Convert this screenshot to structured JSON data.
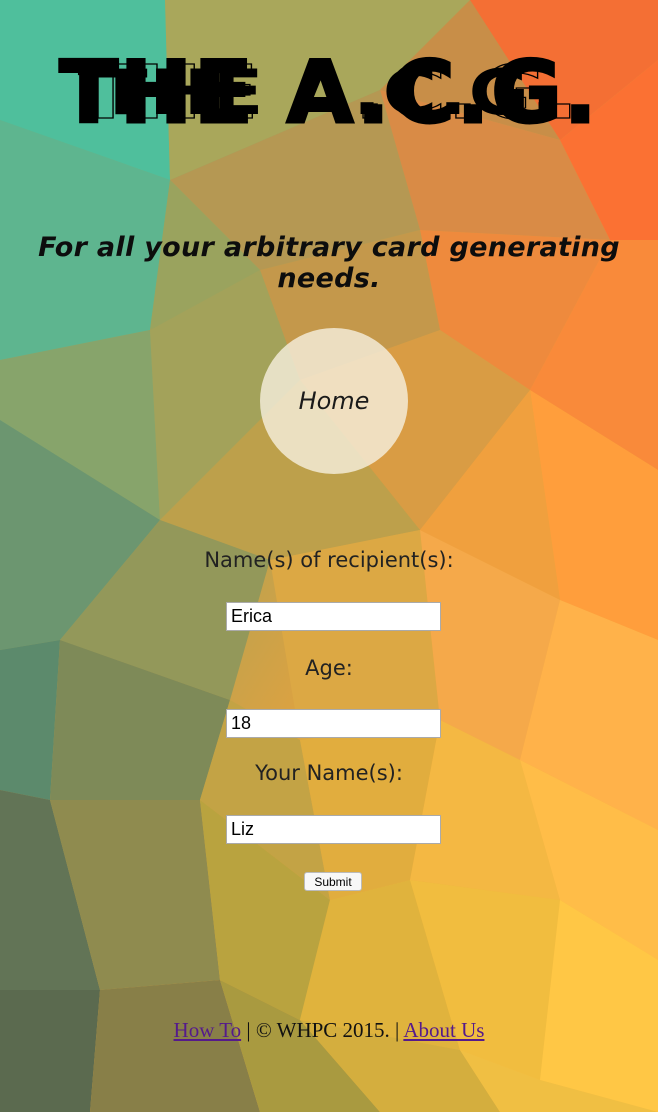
{
  "header": {
    "title": "THE A.C.G.",
    "tagline": "For all your arbitrary card generating needs."
  },
  "nav": {
    "home_label": "Home"
  },
  "form": {
    "recipient_label": "Name(s) of recipient(s):",
    "recipient_value": "Erica",
    "age_label": "Age:",
    "age_value": "18",
    "your_name_label": "Your Name(s):",
    "your_name_value": "Liz",
    "submit_label": "Submit"
  },
  "footer": {
    "how_to_label": "How To",
    "middle_text": " | © WHPC 2015. | ",
    "about_label": "About Us"
  },
  "colors": {
    "top_left": "#4fbf9a",
    "top_right": "#f86a2c",
    "bottom_left": "#5d6b4d",
    "bottom_right": "#ffc745",
    "link": "#551a8b"
  }
}
